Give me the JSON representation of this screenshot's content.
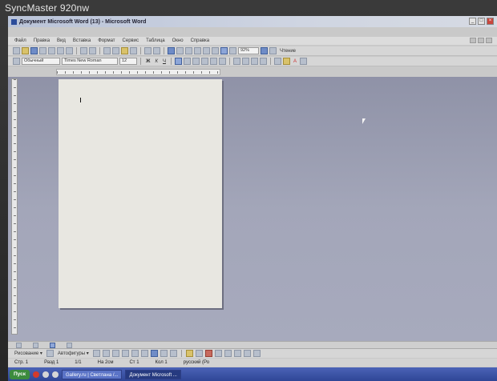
{
  "monitor": {
    "brand": "SyncMaster 920nw"
  },
  "window": {
    "title": "Документ Microsoft Word (13) - Microsoft Word",
    "controls": [
      "_",
      "□",
      "×"
    ]
  },
  "menubar": {
    "items": [
      "Файл",
      "Правка",
      "Вид",
      "Вставка",
      "Формат",
      "Сервис",
      "Таблица",
      "Окно",
      "Справка"
    ]
  },
  "toolbar_standard": {
    "zoom_value": "92%",
    "read_label": "Чтение"
  },
  "toolbar_formatting": {
    "style_value": "Обычный",
    "font_value": "Times New Roman",
    "size_value": "12",
    "bold": "Ж",
    "italic": "К",
    "underline": "Ч",
    "font_color_label": "A"
  },
  "drawbar": {
    "draw_label": "Рисование ▾",
    "autoshapes_label": "Автофигуры ▾"
  },
  "statusbar": {
    "page": "Стр. 1",
    "section": "Разд 1",
    "page_count": "1/1",
    "position": "На 2см",
    "line": "Ст 1",
    "column": "Кол 1",
    "language": "русский (Ро"
  },
  "taskbar": {
    "start_label": "Пуск",
    "buttons": [
      {
        "label": "Gallery.ru | Светлана /..."
      },
      {
        "label": "Документ Microsoft ..."
      }
    ]
  },
  "colors": {
    "workspace": "#a3a6b9",
    "page": "#e8e7e1",
    "taskbar": "#2f4696",
    "start": "#3c8b3d"
  }
}
